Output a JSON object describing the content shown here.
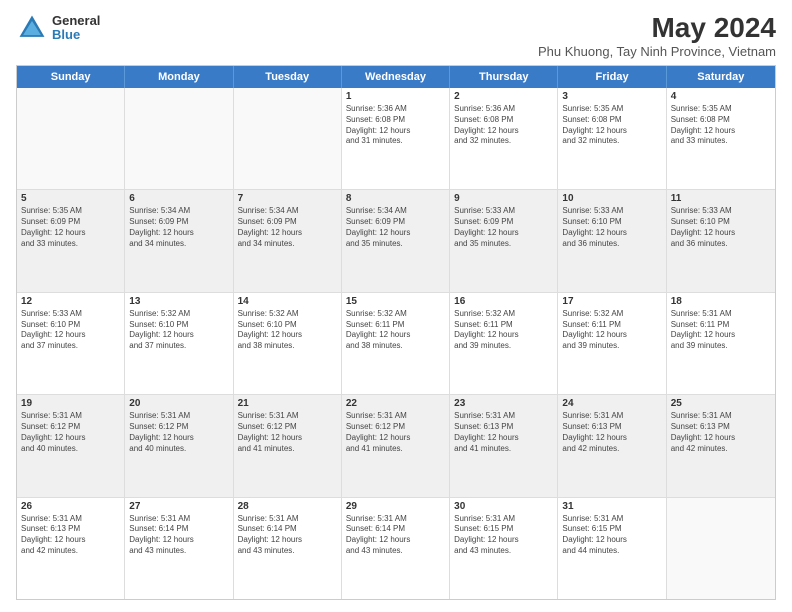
{
  "logo": {
    "general": "General",
    "blue": "Blue"
  },
  "title": {
    "main": "May 2024",
    "sub": "Phu Khuong, Tay Ninh Province, Vietnam"
  },
  "days": [
    "Sunday",
    "Monday",
    "Tuesday",
    "Wednesday",
    "Thursday",
    "Friday",
    "Saturday"
  ],
  "rows": [
    [
      {
        "day": "",
        "lines": []
      },
      {
        "day": "",
        "lines": []
      },
      {
        "day": "",
        "lines": []
      },
      {
        "day": "1",
        "lines": [
          "Sunrise: 5:36 AM",
          "Sunset: 6:08 PM",
          "Daylight: 12 hours",
          "and 31 minutes."
        ]
      },
      {
        "day": "2",
        "lines": [
          "Sunrise: 5:36 AM",
          "Sunset: 6:08 PM",
          "Daylight: 12 hours",
          "and 32 minutes."
        ]
      },
      {
        "day": "3",
        "lines": [
          "Sunrise: 5:35 AM",
          "Sunset: 6:08 PM",
          "Daylight: 12 hours",
          "and 32 minutes."
        ]
      },
      {
        "day": "4",
        "lines": [
          "Sunrise: 5:35 AM",
          "Sunset: 6:08 PM",
          "Daylight: 12 hours",
          "and 33 minutes."
        ]
      }
    ],
    [
      {
        "day": "5",
        "lines": [
          "Sunrise: 5:35 AM",
          "Sunset: 6:09 PM",
          "Daylight: 12 hours",
          "and 33 minutes."
        ]
      },
      {
        "day": "6",
        "lines": [
          "Sunrise: 5:34 AM",
          "Sunset: 6:09 PM",
          "Daylight: 12 hours",
          "and 34 minutes."
        ]
      },
      {
        "day": "7",
        "lines": [
          "Sunrise: 5:34 AM",
          "Sunset: 6:09 PM",
          "Daylight: 12 hours",
          "and 34 minutes."
        ]
      },
      {
        "day": "8",
        "lines": [
          "Sunrise: 5:34 AM",
          "Sunset: 6:09 PM",
          "Daylight: 12 hours",
          "and 35 minutes."
        ]
      },
      {
        "day": "9",
        "lines": [
          "Sunrise: 5:33 AM",
          "Sunset: 6:09 PM",
          "Daylight: 12 hours",
          "and 35 minutes."
        ]
      },
      {
        "day": "10",
        "lines": [
          "Sunrise: 5:33 AM",
          "Sunset: 6:10 PM",
          "Daylight: 12 hours",
          "and 36 minutes."
        ]
      },
      {
        "day": "11",
        "lines": [
          "Sunrise: 5:33 AM",
          "Sunset: 6:10 PM",
          "Daylight: 12 hours",
          "and 36 minutes."
        ]
      }
    ],
    [
      {
        "day": "12",
        "lines": [
          "Sunrise: 5:33 AM",
          "Sunset: 6:10 PM",
          "Daylight: 12 hours",
          "and 37 minutes."
        ]
      },
      {
        "day": "13",
        "lines": [
          "Sunrise: 5:32 AM",
          "Sunset: 6:10 PM",
          "Daylight: 12 hours",
          "and 37 minutes."
        ]
      },
      {
        "day": "14",
        "lines": [
          "Sunrise: 5:32 AM",
          "Sunset: 6:10 PM",
          "Daylight: 12 hours",
          "and 38 minutes."
        ]
      },
      {
        "day": "15",
        "lines": [
          "Sunrise: 5:32 AM",
          "Sunset: 6:11 PM",
          "Daylight: 12 hours",
          "and 38 minutes."
        ]
      },
      {
        "day": "16",
        "lines": [
          "Sunrise: 5:32 AM",
          "Sunset: 6:11 PM",
          "Daylight: 12 hours",
          "and 39 minutes."
        ]
      },
      {
        "day": "17",
        "lines": [
          "Sunrise: 5:32 AM",
          "Sunset: 6:11 PM",
          "Daylight: 12 hours",
          "and 39 minutes."
        ]
      },
      {
        "day": "18",
        "lines": [
          "Sunrise: 5:31 AM",
          "Sunset: 6:11 PM",
          "Daylight: 12 hours",
          "and 39 minutes."
        ]
      }
    ],
    [
      {
        "day": "19",
        "lines": [
          "Sunrise: 5:31 AM",
          "Sunset: 6:12 PM",
          "Daylight: 12 hours",
          "and 40 minutes."
        ]
      },
      {
        "day": "20",
        "lines": [
          "Sunrise: 5:31 AM",
          "Sunset: 6:12 PM",
          "Daylight: 12 hours",
          "and 40 minutes."
        ]
      },
      {
        "day": "21",
        "lines": [
          "Sunrise: 5:31 AM",
          "Sunset: 6:12 PM",
          "Daylight: 12 hours",
          "and 41 minutes."
        ]
      },
      {
        "day": "22",
        "lines": [
          "Sunrise: 5:31 AM",
          "Sunset: 6:12 PM",
          "Daylight: 12 hours",
          "and 41 minutes."
        ]
      },
      {
        "day": "23",
        "lines": [
          "Sunrise: 5:31 AM",
          "Sunset: 6:13 PM",
          "Daylight: 12 hours",
          "and 41 minutes."
        ]
      },
      {
        "day": "24",
        "lines": [
          "Sunrise: 5:31 AM",
          "Sunset: 6:13 PM",
          "Daylight: 12 hours",
          "and 42 minutes."
        ]
      },
      {
        "day": "25",
        "lines": [
          "Sunrise: 5:31 AM",
          "Sunset: 6:13 PM",
          "Daylight: 12 hours",
          "and 42 minutes."
        ]
      }
    ],
    [
      {
        "day": "26",
        "lines": [
          "Sunrise: 5:31 AM",
          "Sunset: 6:13 PM",
          "Daylight: 12 hours",
          "and 42 minutes."
        ]
      },
      {
        "day": "27",
        "lines": [
          "Sunrise: 5:31 AM",
          "Sunset: 6:14 PM",
          "Daylight: 12 hours",
          "and 43 minutes."
        ]
      },
      {
        "day": "28",
        "lines": [
          "Sunrise: 5:31 AM",
          "Sunset: 6:14 PM",
          "Daylight: 12 hours",
          "and 43 minutes."
        ]
      },
      {
        "day": "29",
        "lines": [
          "Sunrise: 5:31 AM",
          "Sunset: 6:14 PM",
          "Daylight: 12 hours",
          "and 43 minutes."
        ]
      },
      {
        "day": "30",
        "lines": [
          "Sunrise: 5:31 AM",
          "Sunset: 6:15 PM",
          "Daylight: 12 hours",
          "and 43 minutes."
        ]
      },
      {
        "day": "31",
        "lines": [
          "Sunrise: 5:31 AM",
          "Sunset: 6:15 PM",
          "Daylight: 12 hours",
          "and 44 minutes."
        ]
      },
      {
        "day": "",
        "lines": []
      }
    ]
  ]
}
